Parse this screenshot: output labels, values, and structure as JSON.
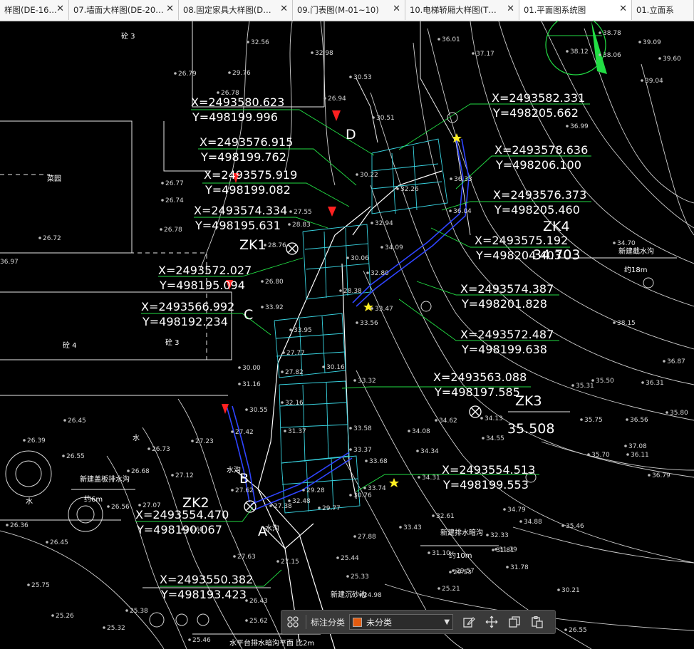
{
  "tabs": [
    {
      "label": "样图(DE-16…",
      "active": false
    },
    {
      "label": "07.墙面大样图(DE-20…",
      "active": false
    },
    {
      "label": "08.固定家具大样图(D…",
      "active": false
    },
    {
      "label": "09.门表图(M-01~10)",
      "active": false
    },
    {
      "label": "10.电梯轿厢大样图(T…",
      "active": false
    },
    {
      "label": "01.平面图系统图",
      "active": true
    },
    {
      "label": "01.立面系",
      "active": false
    }
  ],
  "drawing": {
    "coordinates": [
      {
        "x": "X=2493580.623",
        "y": "Y=498199.996"
      },
      {
        "x": "X=2493576.915",
        "y": "Y=498199.762"
      },
      {
        "x": "X=2493575.919",
        "y": "Y=498199.082"
      },
      {
        "x": "X=2493574.334",
        "y": "Y=498195.631"
      },
      {
        "x": "X=2493572.027",
        "y": "Y=498195.094"
      },
      {
        "x": "X=2493566.992",
        "y": "Y=498192.234"
      },
      {
        "x": "X=2493554.470",
        "y": "Y=498190.067"
      },
      {
        "x": "X=2493550.382",
        "y": "Y=498193.423"
      },
      {
        "x": "X=2493582.331",
        "y": "Y=498205.662"
      },
      {
        "x": "X=2493578.636",
        "y": "Y=498206.100"
      },
      {
        "x": "X=2493576.373",
        "y": "Y=498205.460"
      },
      {
        "x": "X=2493575.192",
        "y": "Y=498204.403"
      },
      {
        "x": "X=2493574.387",
        "y": "Y=498201.828"
      },
      {
        "x": "X=2493572.487",
        "y": "Y=498199.638"
      },
      {
        "x": "X=2493563.088",
        "y": "Y=498197.585"
      },
      {
        "x": "X=2493554.513",
        "y": "Y=498199.553"
      }
    ],
    "points": [
      "D",
      "C",
      "B",
      "A"
    ],
    "boreholes": [
      "ZK1",
      "ZK2",
      "ZK3",
      "ZK4"
    ],
    "zk3_value": "35.508",
    "zk4_value": "34.703",
    "notes": [
      "新建截水沟",
      "约18m",
      "新建盖板排水沟",
      "约6m",
      "新建排水暗沟",
      "约10m",
      "新建沉砂池",
      "水平台排水暗沟平面 比2m",
      "水沟",
      "水沟"
    ],
    "elevations": [
      "32.56",
      "32.98",
      "36.01",
      "37.17",
      "38.78",
      "39.09",
      "29.76",
      "26.79",
      "38.06",
      "38.12",
      "39.60",
      "26.78",
      "26.94",
      "30.53",
      "39.04",
      "30.51",
      "36.99",
      "26.77",
      "30.22",
      "36.33",
      "26.74",
      "27.55",
      "32.26",
      "36.04",
      "28.83",
      "32.94",
      "34.09",
      "26.72",
      "26.78",
      "28.76",
      "34.70",
      "36.97",
      "26.80",
      "30.06",
      "32.80",
      "33.92",
      "28.38",
      "33.47",
      "33.56",
      "33.95",
      "30.00",
      "27.77",
      "30.16",
      "30.55",
      "27.82",
      "31.16",
      "33.32",
      "27.42",
      "32.16",
      "33.58",
      "34.08",
      "34.62",
      "34.13",
      "35.31",
      "35.75",
      "36.56",
      "35.70",
      "27.23",
      "31.37",
      "33.37",
      "33.68",
      "34.34",
      "26.45",
      "26.73",
      "26.68",
      "26.39",
      "26.55",
      "27.12",
      "29.28",
      "33.74",
      "34.31",
      "26.56",
      "27.07",
      "32.48",
      "27.62",
      "30.76",
      "32.61",
      "34.88",
      "35.46",
      "26.36",
      "27.38",
      "33.43",
      "32.33",
      "26.45",
      "27.63",
      "27.88",
      "31.79",
      "27.15",
      "31.10",
      "29.57",
      "31.78",
      "25.75",
      "26.43",
      "25.44",
      "25.33",
      "24.98",
      "25.21",
      "30.21",
      "25.38",
      "25.26",
      "25.32",
      "25.62",
      "25.46",
      "26.55",
      "38.15",
      "36.87",
      "35.80",
      "36.31",
      "35.50",
      "37.08",
      "36.79",
      "31.81",
      "29.53",
      "34.55",
      "34.79",
      "36.11",
      "29.77",
      "26.60"
    ],
    "building_labels": [
      "砼 3",
      "砼 4",
      "砼 3",
      "菜园",
      "水",
      "水"
    ]
  },
  "toolbar": {
    "label": "标注分类",
    "select_value": "未分类",
    "swatch_color": "#e35b10"
  }
}
